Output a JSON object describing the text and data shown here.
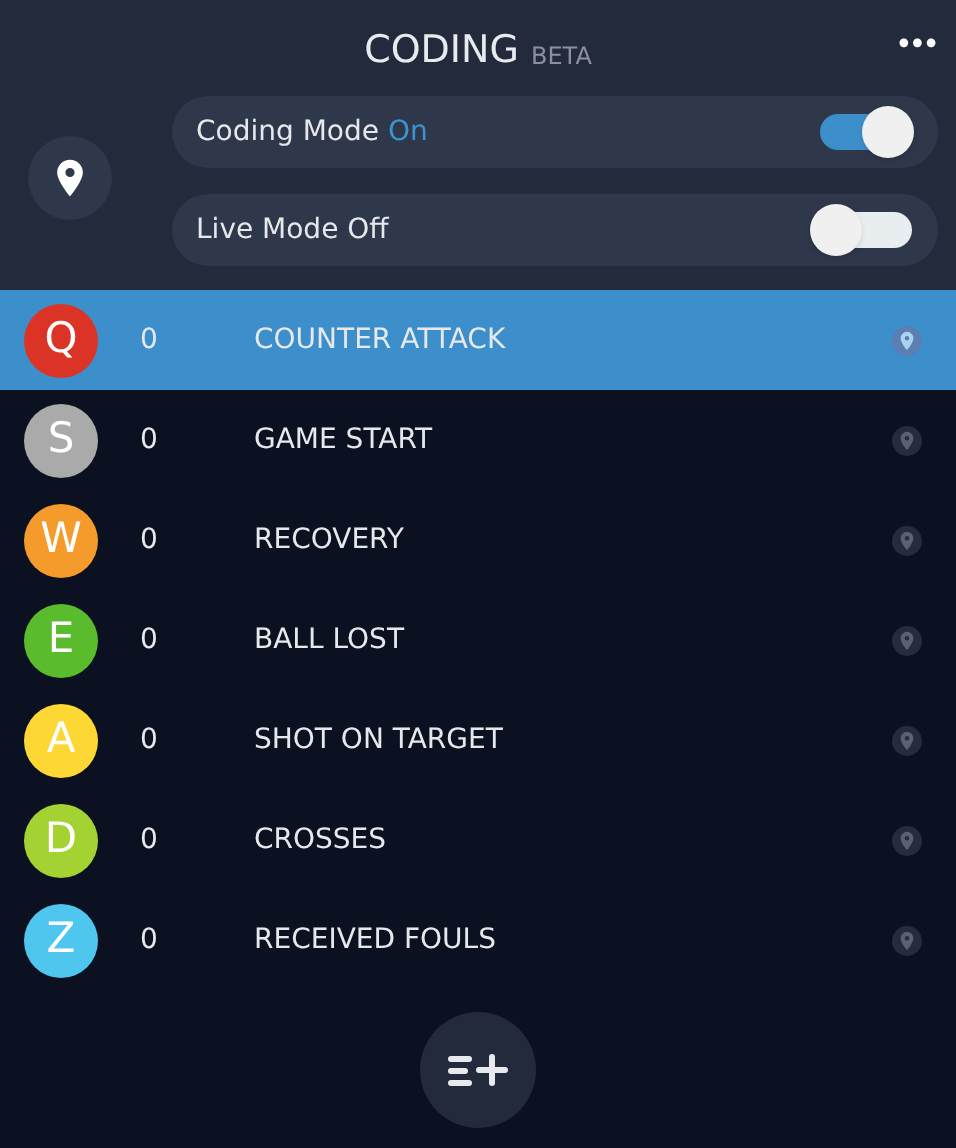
{
  "header": {
    "title": "CODING",
    "badge": "BETA",
    "menu": "•••"
  },
  "toggles": [
    {
      "label": "Coding Mode",
      "status": "On",
      "on": true
    },
    {
      "label": "Live Mode",
      "status": "Off",
      "on": false
    }
  ],
  "codes": [
    {
      "key": "Q",
      "color": "#dc3327",
      "count": "0",
      "name": "COUNTER ATTACK",
      "selected": true
    },
    {
      "key": "S",
      "color": "#aaaaaa",
      "count": "0",
      "name": "GAME START",
      "selected": false
    },
    {
      "key": "W",
      "color": "#f59b2b",
      "count": "0",
      "name": "RECOVERY",
      "selected": false
    },
    {
      "key": "E",
      "color": "#5abb2d",
      "count": "0",
      "name": "BALL LOST",
      "selected": false
    },
    {
      "key": "A",
      "color": "#fdd835",
      "count": "0",
      "name": "SHOT ON TARGET",
      "selected": false
    },
    {
      "key": "D",
      "color": "#a4d233",
      "count": "0",
      "name": "CROSSES",
      "selected": false
    },
    {
      "key": "Z",
      "color": "#4fc6ee",
      "count": "0",
      "name": "RECEIVED FOULS",
      "selected": false
    }
  ]
}
